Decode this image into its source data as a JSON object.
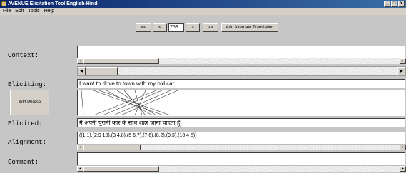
{
  "window": {
    "title": "AVENUE Elicitation Tool English-Hindi",
    "minimize": "_",
    "maximize": "□",
    "close": "x"
  },
  "menu": [
    "File",
    "Edit",
    "Tools",
    "Help"
  ],
  "toolbar": {
    "first": "<<",
    "prev": "<",
    "page": "758",
    "next": ">",
    "last": ">>",
    "add_alt": "Add Alternate Translation"
  },
  "labels": {
    "context": "Context:",
    "eliciting": "Eliciting:",
    "elicited": "Elicited:",
    "alignment": "Alignment:",
    "comment": "Comment:"
  },
  "eliciting_text": "I want to drive to town with my old car",
  "elicited_text": "मैं अपनी पुरानी कार के साथ शहर जाना चाहता हूँ",
  "alignment_text": "((1,1),(2,9 10),(3 4,8),(5 6,7),(7,6),(8,2),(9,3),(10,4 5))",
  "add_phrase": "Add Phrase",
  "context_text": "",
  "comment_text": "",
  "icons": {
    "scroll_left": "◄",
    "scroll_right": "►",
    "small_left": "◂",
    "small_right": "▸"
  }
}
